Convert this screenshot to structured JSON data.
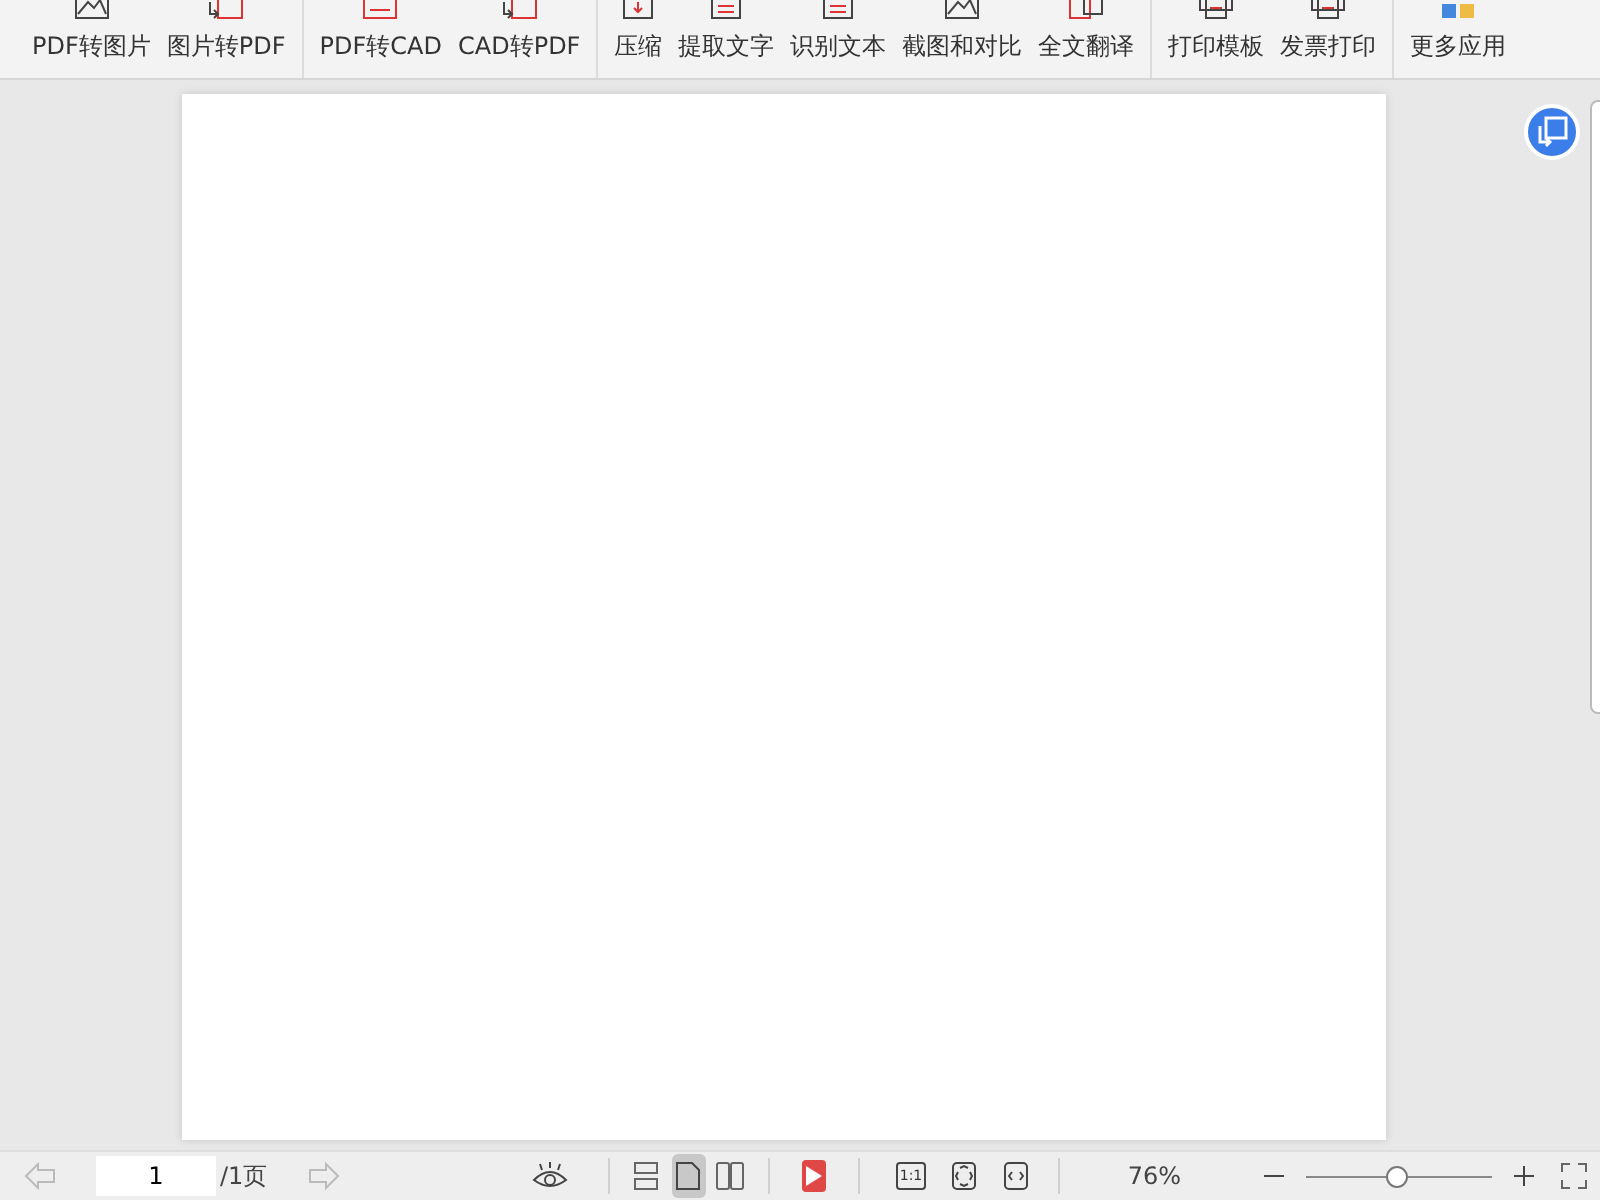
{
  "toolbar": {
    "groups": [
      {
        "items": [
          {
            "label": "PDF转图片",
            "kind": "image"
          },
          {
            "label": "图片转PDF",
            "kind": "convert"
          }
        ]
      },
      {
        "items": [
          {
            "label": "PDF转CAD",
            "kind": "cad"
          },
          {
            "label": "CAD转PDF",
            "kind": "convert"
          }
        ]
      },
      {
        "items": [
          {
            "label": "压缩",
            "kind": "compress"
          },
          {
            "label": "提取文字",
            "kind": "doc"
          },
          {
            "label": "识别文本",
            "kind": "doc"
          },
          {
            "label": "截图和对比",
            "kind": "image"
          },
          {
            "label": "全文翻译",
            "kind": "translate"
          }
        ]
      },
      {
        "items": [
          {
            "label": "打印模板",
            "kind": "printer"
          },
          {
            "label": "发票打印",
            "kind": "printer"
          }
        ]
      },
      {
        "items": [
          {
            "label": "更多应用",
            "kind": "apps"
          }
        ]
      }
    ]
  },
  "status_bar": {
    "page_input": {
      "value": "1"
    },
    "page_total": "/1页",
    "view_modes": [
      {
        "kind": "continuous",
        "selected": false
      },
      {
        "kind": "single",
        "selected": true
      },
      {
        "kind": "double",
        "selected": false
      }
    ],
    "actual_size_label": "1:1",
    "zoom": "76%",
    "zoom_slider": {
      "level": 0.5
    }
  }
}
